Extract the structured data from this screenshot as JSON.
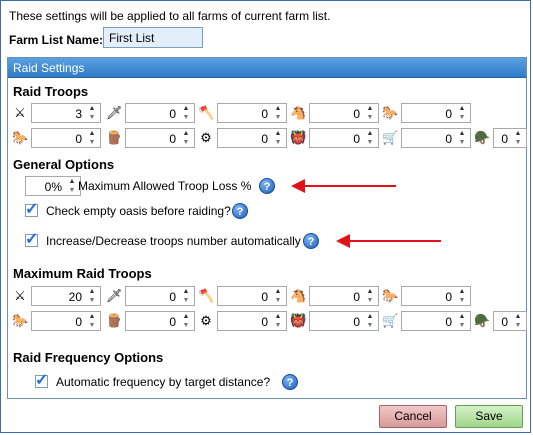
{
  "top_note": "These settings will be applied to all farms of current farm list.",
  "farm_list": {
    "label": "Farm List Name:",
    "value": "First List"
  },
  "panel_title": "Raid Settings",
  "raid_troops": {
    "title": "Raid Troops",
    "row1": [
      {
        "icon": "clubswinger-icon",
        "glyph": "⚔",
        "value": "3"
      },
      {
        "icon": "spearman-icon",
        "glyph": "🗡",
        "value": "0"
      },
      {
        "icon": "axeman-icon",
        "glyph": "🪓",
        "value": "0"
      },
      {
        "icon": "scout-icon",
        "glyph": "🐴",
        "value": "0"
      },
      {
        "icon": "paladin-icon",
        "glyph": "🐎",
        "value": "0"
      }
    ],
    "row2": [
      {
        "icon": "teutonic-knight-icon",
        "glyph": "🐎",
        "value": "0"
      },
      {
        "icon": "ram-icon",
        "glyph": "🪵",
        "value": "0"
      },
      {
        "icon": "catapult-icon",
        "glyph": "⚙",
        "value": "0"
      },
      {
        "icon": "chief-icon",
        "glyph": "👹",
        "value": "0"
      },
      {
        "icon": "settler-icon",
        "glyph": "🛒",
        "value": "0"
      },
      {
        "icon": "hero-icon",
        "glyph": "🪖",
        "value": "0"
      }
    ]
  },
  "general_options": {
    "title": "General Options",
    "loss_value": "0%",
    "loss_label": "Maximum Allowed Troop Loss %",
    "check_oasis_label": "Check empty oasis before raiding?",
    "auto_troops_label": "Increase/Decrease troops number automatically"
  },
  "max_raid_troops": {
    "title": "Maximum Raid Troops",
    "row1": [
      {
        "icon": "clubswinger-icon",
        "glyph": "⚔",
        "value": "20"
      },
      {
        "icon": "spearman-icon",
        "glyph": "🗡",
        "value": "0"
      },
      {
        "icon": "axeman-icon",
        "glyph": "🪓",
        "value": "0"
      },
      {
        "icon": "scout-icon",
        "glyph": "🐴",
        "value": "0"
      },
      {
        "icon": "paladin-icon",
        "glyph": "🐎",
        "value": "0"
      }
    ],
    "row2": [
      {
        "icon": "teutonic-knight-icon",
        "glyph": "🐎",
        "value": "0"
      },
      {
        "icon": "ram-icon",
        "glyph": "🪵",
        "value": "0"
      },
      {
        "icon": "catapult-icon",
        "glyph": "⚙",
        "value": "0"
      },
      {
        "icon": "chief-icon",
        "glyph": "👹",
        "value": "0"
      },
      {
        "icon": "settler-icon",
        "glyph": "🛒",
        "value": "0"
      },
      {
        "icon": "hero-icon",
        "glyph": "🪖",
        "value": "0"
      }
    ]
  },
  "raid_frequency": {
    "title": "Raid Frequency Options",
    "auto_frequency_label": "Automatic frequency by target distance?"
  },
  "help_glyph": "?",
  "spin_up": "▲",
  "spin_down": "▼",
  "buttons": {
    "cancel": "Cancel",
    "save": "Save"
  },
  "colors": {
    "header": "#3a86d4",
    "arrow": "#e0131a",
    "cancel": "#e4b0b0",
    "save": "#b7e3a4"
  }
}
